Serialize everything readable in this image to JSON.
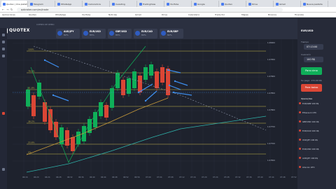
{
  "browser": {
    "tabs": [
      {
        "label": "Quotex | Una plataforma"
      },
      {
        "label": "Telegram"
      },
      {
        "label": "WhatsApp"
      },
      {
        "label": "Calculadora"
      },
      {
        "label": "Investing"
      },
      {
        "label": "TradingView"
      },
      {
        "label": "YouTube"
      },
      {
        "label": "Google"
      },
      {
        "label": "Quotex"
      },
      {
        "label": "Drive"
      },
      {
        "label": "Gmail"
      },
      {
        "label": "Nueva pestaña"
      }
    ],
    "url": "qxbroker.com/es/trade",
    "bookmarks": [
      "Aplicaciones",
      "Quotex",
      "WhatsApp",
      "YouTube",
      "Noticias",
      "Gmail",
      "Drive",
      "Calendario",
      "Traductor",
      "Mapas",
      "Binance",
      "Finanzas"
    ]
  },
  "brand": {
    "logo": "QUOTEX",
    "subtitle": "CUENTA DE DEMO"
  },
  "assets": [
    {
      "name": "AUD/JPY",
      "pct": "82%"
    },
    {
      "name": "EUR/USD",
      "pct": "85%"
    },
    {
      "name": "GBP/USD",
      "pct": "85%"
    },
    {
      "name": "EUR/CAD",
      "pct": "80%"
    },
    {
      "name": "EUR/GBP",
      "pct": "82%"
    }
  ],
  "header_buttons": {
    "deposit": "Depósito",
    "withdraw": "Retirada"
  },
  "panel": {
    "pair": "EUR/USD",
    "time_label": "Tiempo",
    "time_value": "07:13:00",
    "amount_label": "Inversión",
    "amount_value": "100 R$",
    "payout_label": "Su pago:",
    "payout_value": "172,00 R$",
    "up_label": "Para cima",
    "down_label": "Para baixo",
    "ops_title": "Operações",
    "operations": [
      "EUR/GBP  100 R$",
      "Ethereum OTC",
      "GBP/USD  100 R$",
      "EUR/CAD  100 R$",
      "USD/JPY  100 R$",
      "EUR/USD  100 R$",
      "AUD/JPY  100 R$",
      "Litecoin OTC"
    ]
  },
  "price_axis": [
    "1.08000",
    "1.07950",
    "1.07900",
    "1.07850",
    "1.07800",
    "1.07750",
    "1.07700",
    "1.07650"
  ],
  "time_axis": [
    "06:16",
    "06:20",
    "06:24",
    "06:28",
    "06:32",
    "06:36",
    "06:40",
    "06:44",
    "06:48",
    "06:52",
    "06:56",
    "07:00",
    "07:04",
    "07:08",
    "07:12",
    "07:16",
    "07:20",
    "07:24",
    "07:28",
    "07:32",
    "07:36",
    "07:40",
    "07:44",
    "07:48",
    "07:52"
  ],
  "fib_levels": [
    "100%",
    "78.6%",
    "61.8%",
    "50%",
    "38.2%",
    "23.6%",
    "0%"
  ],
  "colors": {
    "up": "#0faf59",
    "down": "#db4635",
    "bg": "#1e222d",
    "fib": "#c9b84a",
    "arrow": "#3d8ff0"
  }
}
